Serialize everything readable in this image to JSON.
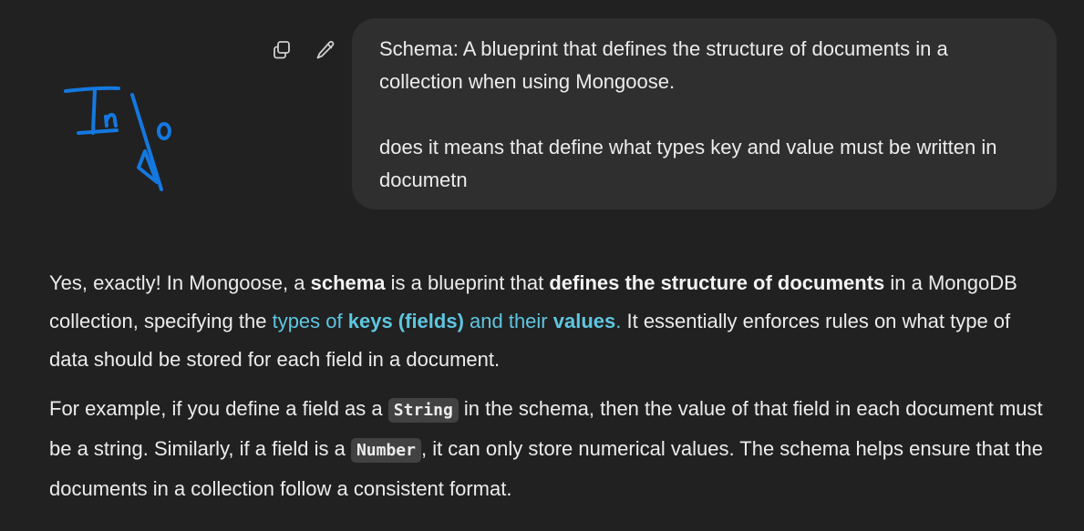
{
  "user_message": {
    "line1": "Schema: A blueprint that defines the structure of documents in a collection when using Mongoose.",
    "line2": "does it means that define what types key and value must be written in documetn"
  },
  "message_actions": {
    "copy_icon": "copy-icon",
    "edit_icon": "pencil-icon"
  },
  "annotation": {
    "handwritten_text": "Info",
    "stroke_color": "#1478e0"
  },
  "assistant_reply": {
    "p1_a": "Yes, exactly! In Mongoose, a ",
    "p1_b": "schema",
    "p1_c": " is a blueprint that ",
    "p1_d": "defines the structure of documents",
    "p1_e": " in a MongoDB collection, specifying the ",
    "p1_f": "types of ",
    "p1_g": "keys (fields)",
    "p1_h": " and their ",
    "p1_i": "values",
    "p1_j": ".",
    "p1_k": " It essentially enforces rules on what type of data should be stored for each field in a document.",
    "p2_a": "For example, if you define a field as a ",
    "p2_code1": "String",
    "p2_b": " in the schema, then the value of that field in each document must be a string. Similarly, if a field is a ",
    "p2_code2": "Number",
    "p2_c": ", it can only store numerical values. The schema helps ensure that the documents in a collection follow a consistent format."
  },
  "colors": {
    "background": "#212121",
    "bubble": "#2f2f2f",
    "highlight": "#5ec6e0",
    "code_bg": "#424242"
  }
}
